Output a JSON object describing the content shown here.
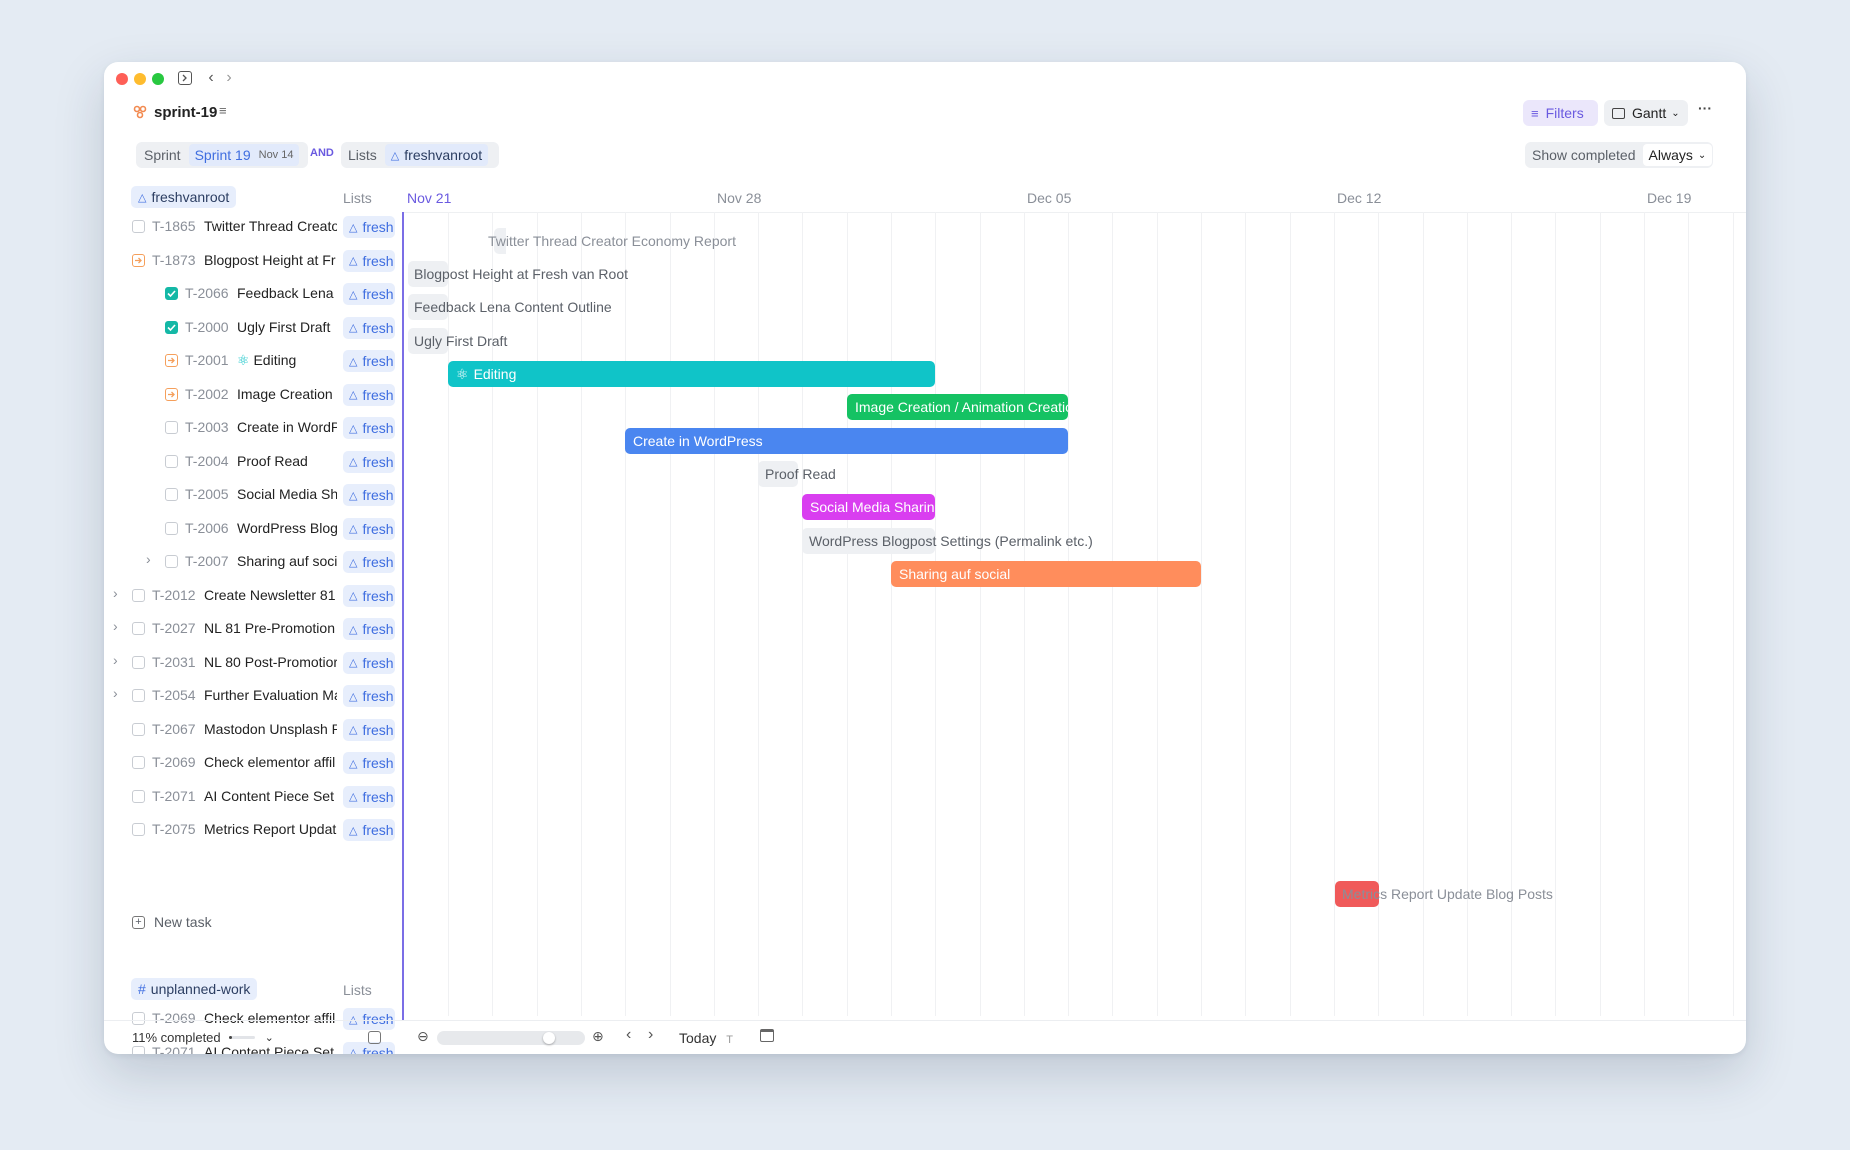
{
  "app": {
    "title": "sprint-19",
    "filters_label": "Filters",
    "view_label": "Gantt",
    "more_label": "···"
  },
  "filterbar": {
    "sprint_label": "Sprint",
    "sprint_value": "Sprint 19",
    "sprint_date": "Nov 14",
    "and_label": "AND",
    "lists_label": "Lists",
    "lists_value": "freshvanroot",
    "show_completed_label": "Show completed",
    "show_completed_value": "Always"
  },
  "groups": [
    {
      "name": "freshvanroot",
      "lists_header": "Lists",
      "new_task_label": "New task"
    },
    {
      "name": "unplanned-work",
      "lists_header": "Lists"
    }
  ],
  "timeline": {
    "dates": [
      "Nov 21",
      "Nov 28",
      "Dec 05",
      "Dec 12",
      "Dec 19"
    ]
  },
  "tasks": [
    {
      "id": "T-1865",
      "name": "Twitter Thread Creato",
      "list": "fresh",
      "status": "todo",
      "bar": "Twitter Thread Creator Economy Report"
    },
    {
      "id": "T-1873",
      "name": "Blogpost Height at Fr",
      "list": "fresh",
      "status": "progress",
      "bar": "Blogpost Height at Fresh van Root"
    },
    {
      "id": "T-2066",
      "name": "Feedback Lena",
      "list": "fresh",
      "status": "done",
      "bar": "Feedback Lena Content Outline"
    },
    {
      "id": "T-2000",
      "name": "Ugly First Draft",
      "list": "fresh",
      "status": "done",
      "bar": "Ugly First Draft"
    },
    {
      "id": "T-2001",
      "name": "Editing",
      "list": "fresh",
      "status": "progress",
      "bar": "Editing"
    },
    {
      "id": "T-2002",
      "name": "Image Creation ,",
      "list": "fresh",
      "status": "progress",
      "bar": "Image Creation / Animation Creation"
    },
    {
      "id": "T-2003",
      "name": "Create in WordP",
      "list": "fresh",
      "status": "todo",
      "bar": "Create in WordPress"
    },
    {
      "id": "T-2004",
      "name": "Proof Read",
      "list": "fresh",
      "status": "todo",
      "bar": "Proof Read"
    },
    {
      "id": "T-2005",
      "name": "Social Media Sh",
      "list": "fresh",
      "status": "todo",
      "bar": "Social Media Sharing Image"
    },
    {
      "id": "T-2006",
      "name": "WordPress Blog",
      "list": "fresh",
      "status": "todo",
      "bar": "WordPress Blogpost Settings (Permalink etc.)"
    },
    {
      "id": "T-2007",
      "name": "Sharing auf soci",
      "list": "fresh",
      "status": "todo",
      "bar": "Sharing auf social"
    },
    {
      "id": "T-2012",
      "name": "Create Newsletter 81",
      "list": "fresh",
      "status": "todo"
    },
    {
      "id": "T-2027",
      "name": "NL 81 Pre-Promotion",
      "list": "fresh",
      "status": "todo"
    },
    {
      "id": "T-2031",
      "name": "NL 80 Post-Promotior",
      "list": "fresh",
      "status": "todo"
    },
    {
      "id": "T-2054",
      "name": "Further Evaluation Ma",
      "list": "fresh",
      "status": "todo"
    },
    {
      "id": "T-2067",
      "name": "Mastodon Unsplash P",
      "list": "fresh",
      "status": "todo"
    },
    {
      "id": "T-2069",
      "name": "Check elementor affil",
      "list": "fresh",
      "status": "todo"
    },
    {
      "id": "T-2071",
      "name": "AI Content Piece Set",
      "list": "fresh",
      "status": "todo"
    },
    {
      "id": "T-2075",
      "name": "Metrics Report Updat",
      "list": "fresh",
      "status": "todo",
      "bar": "Metrics Report Update Blog Posts"
    }
  ],
  "unplanned_tasks": [
    {
      "id": "T-2069",
      "name": "Check elementor affil",
      "list": "fresh",
      "status": "todo"
    },
    {
      "id": "T-2071",
      "name": "AI Content Piece Set",
      "list": "fresh",
      "status": "todo"
    }
  ],
  "footer": {
    "completed_label": "11% completed",
    "today_label": "Today",
    "today_shortcut": "T"
  },
  "colors": {
    "editing": "#10c4c8",
    "image_creation": "#15c263",
    "create_wordpress": "#4a86f0",
    "social_media": "#d93ef0",
    "sharing_social": "#ff8d5c",
    "metrics": "#f05a5a",
    "accent": "#6a5ae0"
  }
}
